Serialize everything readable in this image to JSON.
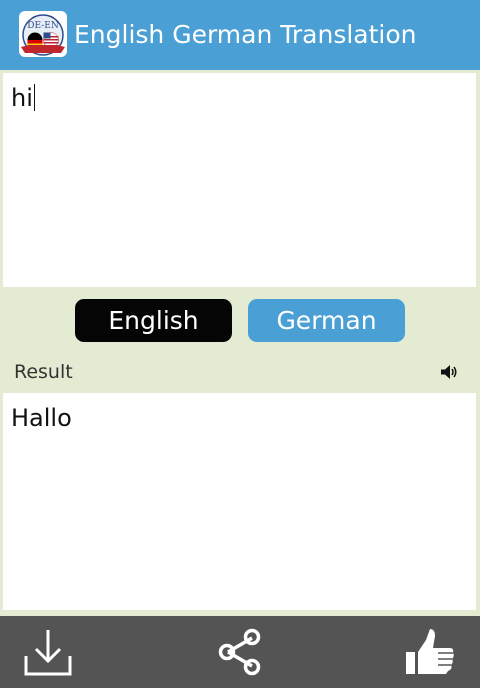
{
  "app": {
    "title": "English German Translation",
    "logo_text": "DE-EN"
  },
  "input": {
    "value": "hi"
  },
  "languages": {
    "source": "English",
    "target": "German"
  },
  "result": {
    "label": "Result",
    "value": "Hallo"
  },
  "icons": {
    "logo": "flag-logo-icon",
    "speaker": "speaker-icon",
    "download": "download-icon",
    "share": "share-icon",
    "like": "thumbs-up-icon"
  },
  "colors": {
    "accent": "#4a9fd5",
    "background": "#e3ebd3",
    "bottom_bar": "#545454",
    "source_button": "#050505"
  }
}
